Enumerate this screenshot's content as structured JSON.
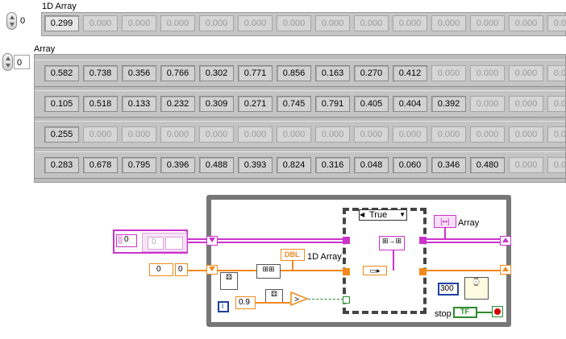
{
  "array1d": {
    "label": "1D Array",
    "index": "0",
    "values": [
      "0.299",
      "0.000",
      "0.000",
      "0.000",
      "0.000",
      "0.000",
      "0.000",
      "0.000",
      "0.000",
      "0.000",
      "0.000",
      "0.000",
      "0.000",
      "0.000"
    ]
  },
  "array2d": {
    "label": "Array",
    "index": "0",
    "rows": [
      [
        "0.582",
        "0.738",
        "0.356",
        "0.766",
        "0.302",
        "0.771",
        "0.856",
        "0.163",
        "0.270",
        "0.412",
        "0.000",
        "0.000",
        "0.000",
        "0.000"
      ],
      [
        "0.105",
        "0.518",
        "0.133",
        "0.232",
        "0.309",
        "0.271",
        "0.745",
        "0.791",
        "0.405",
        "0.404",
        "0.392",
        "0.000",
        "0.000",
        "0.000"
      ],
      [
        "0.255",
        "0.000",
        "0.000",
        "0.000",
        "0.000",
        "0.000",
        "0.000",
        "0.000",
        "0.000",
        "0.000",
        "0.000",
        "0.000",
        "0.000",
        "0.000"
      ],
      [
        "0.283",
        "0.678",
        "0.795",
        "0.396",
        "0.488",
        "0.393",
        "0.824",
        "0.316",
        "0.048",
        "0.060",
        "0.346",
        "0.480",
        "0.000",
        "0.000"
      ]
    ],
    "active_counts": [
      10,
      11,
      1,
      12
    ]
  },
  "diagram": {
    "array_const_index": "0",
    "array_const_inner": "0",
    "init_index": "0",
    "init_value": "0",
    "case_selector": "True",
    "dbl_label": "DBL",
    "dbl_caption": "1D Array",
    "array_indicator_caption": "Array",
    "threshold": "0.9",
    "wait_ms": "300",
    "iteration": "i",
    "stop_label": "stop",
    "stop_terminal": "TF",
    "colors": {
      "pink_wire": "#cc33cc",
      "orange_wire": "#f08a1c",
      "green_wire": "#2e8b2e",
      "loop_border": "#777777",
      "blue_const": "#1f3fa0"
    }
  }
}
